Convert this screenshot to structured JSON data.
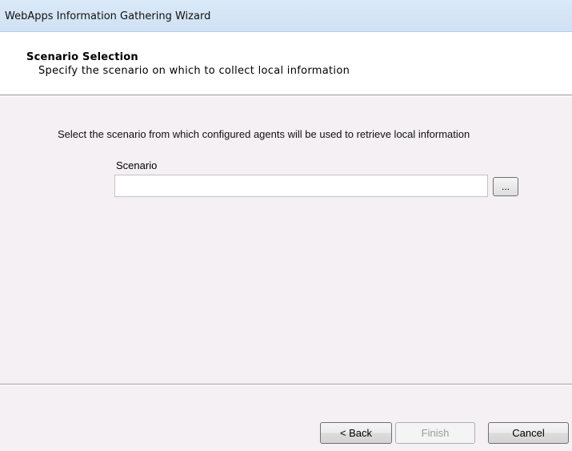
{
  "window": {
    "title": "WebApps Information Gathering Wizard"
  },
  "header": {
    "heading": "Scenario Selection",
    "subheading": "Specify the scenario on which to collect local information"
  },
  "content": {
    "instruction": "Select the scenario from which configured agents will be used to retrieve local information",
    "scenario_label": "Scenario",
    "scenario_value": "",
    "browse_label": "..."
  },
  "footer": {
    "back_label": "< Back",
    "finish_label": "Finish",
    "finish_enabled": false,
    "cancel_label": "Cancel"
  }
}
